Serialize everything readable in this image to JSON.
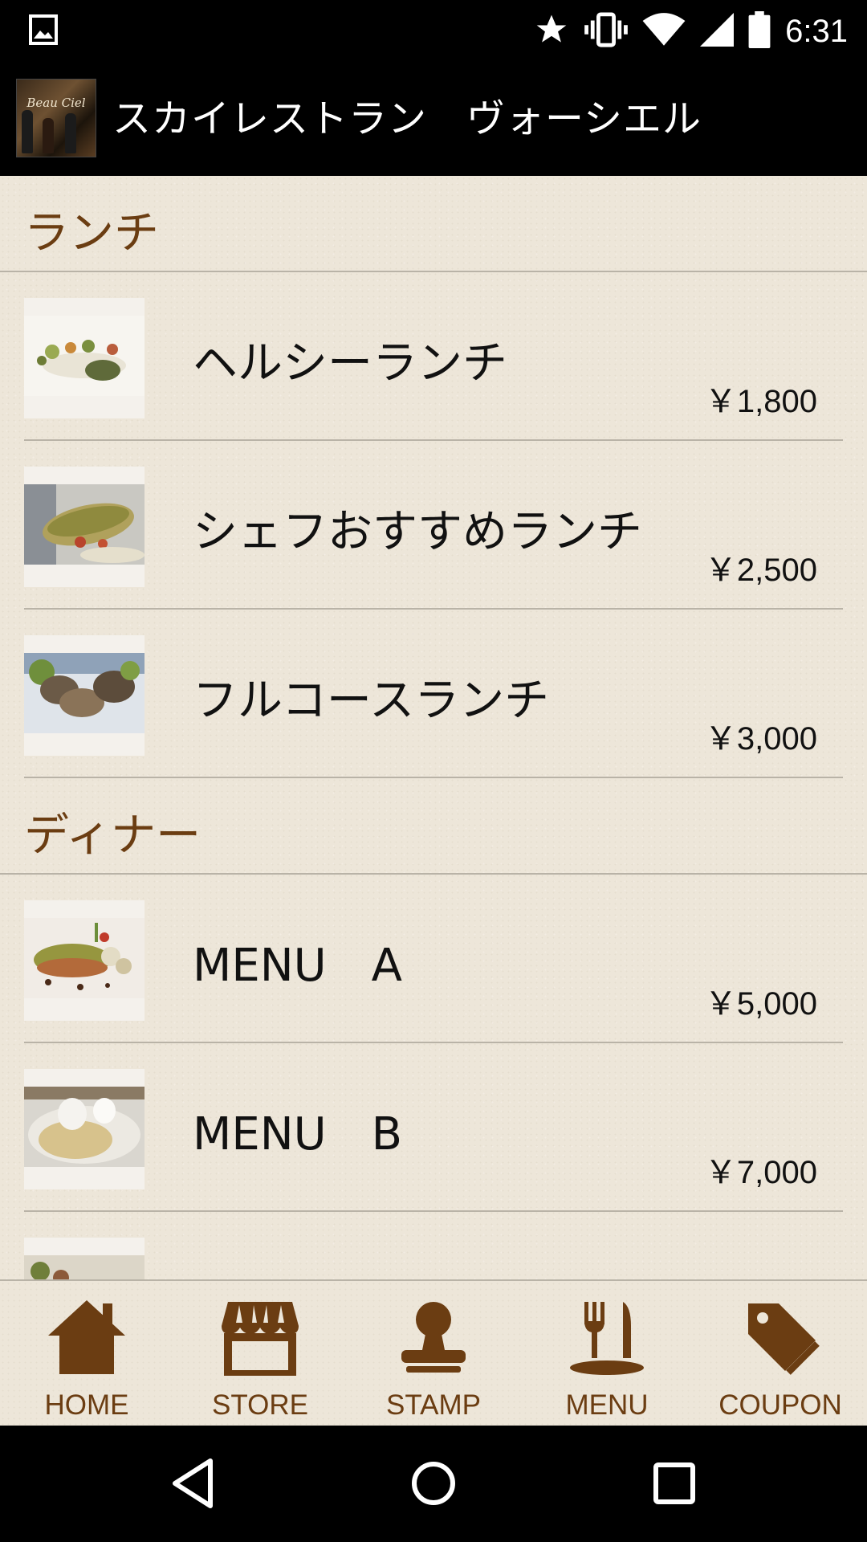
{
  "status_bar": {
    "time": "6:31",
    "icons": [
      "image-icon",
      "star-icon",
      "vibrate-icon",
      "wifi-icon",
      "signal-icon",
      "battery-icon"
    ]
  },
  "app_bar": {
    "title": "スカイレストラン　ヴォーシエル",
    "logo_text": "Beau Ciel"
  },
  "sections": [
    {
      "title": "ランチ",
      "items": [
        {
          "name": "ヘルシーランチ",
          "price": "￥1,800",
          "thumb_color": "#c7c19a"
        },
        {
          "name": "シェフおすすめランチ",
          "price": "￥2,500",
          "thumb_color": "#a48a5c"
        },
        {
          "name": "フルコースランチ",
          "price": "￥3,000",
          "thumb_color": "#7c6a52"
        }
      ]
    },
    {
      "title": "ディナー",
      "items": [
        {
          "name": "MENU　A",
          "price": "￥5,000",
          "thumb_color": "#8a8a3a"
        },
        {
          "name": "MENU　B",
          "price": "￥7,000",
          "thumb_color": "#cfc6a8"
        }
      ]
    }
  ],
  "bottom_nav": [
    {
      "label": "HOME",
      "icon": "home-icon"
    },
    {
      "label": "STORE",
      "icon": "store-icon"
    },
    {
      "label": "STAMP",
      "icon": "stamp-icon"
    },
    {
      "label": "MENU",
      "icon": "menu-fork-knife-icon"
    },
    {
      "label": "COUPON",
      "icon": "coupon-tag-icon"
    }
  ],
  "colors": {
    "accent_brown": "#6b3d12",
    "background": "#ede6d9",
    "divider": "#b9b3a7"
  }
}
